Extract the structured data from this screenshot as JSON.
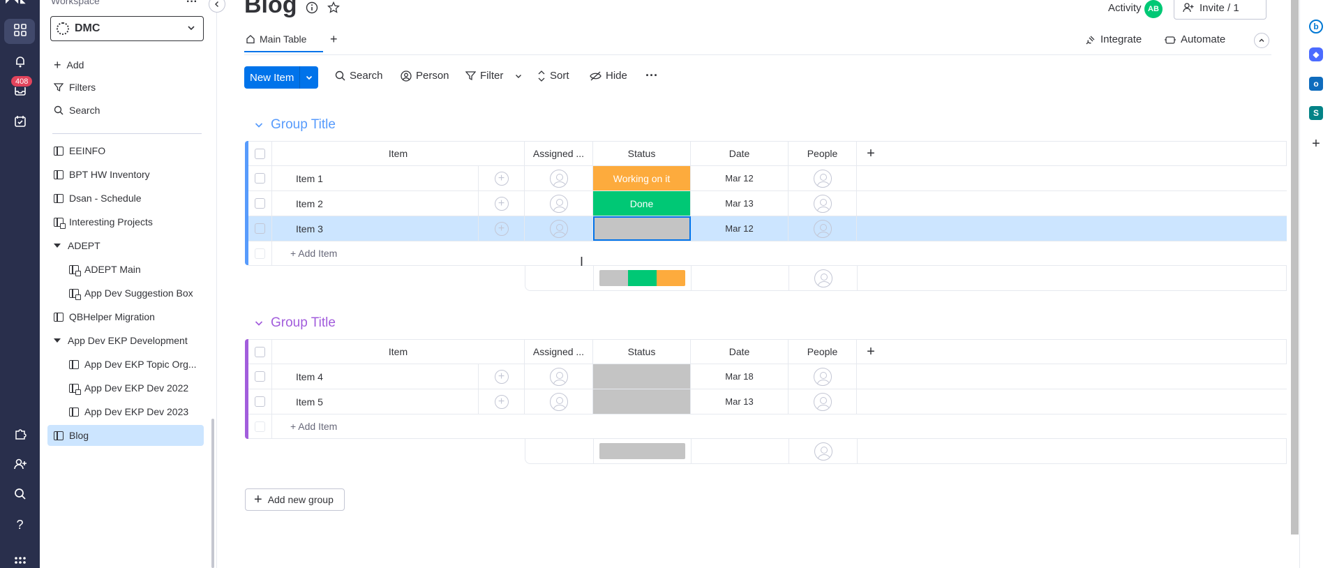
{
  "rail": {
    "inbox_badge": "408"
  },
  "sidebar": {
    "workspace_label": "Workspace",
    "workspace_name": "DMC",
    "actions": [
      {
        "label": "Add",
        "icon": "plus-icon"
      },
      {
        "label": "Filters",
        "icon": "filter-icon"
      },
      {
        "label": "Search",
        "icon": "search-icon"
      }
    ],
    "items": [
      {
        "label": "EEINFO",
        "icon": "board-icon"
      },
      {
        "label": "BPT HW Inventory",
        "icon": "board-icon"
      },
      {
        "label": "Dsan - Schedule",
        "icon": "board-icon"
      },
      {
        "label": "Interesting Projects",
        "icon": "private-board-icon"
      },
      {
        "label": "ADEPT",
        "icon": "folder-caret-icon"
      },
      {
        "label": "ADEPT Main",
        "icon": "private-board-icon"
      },
      {
        "label": "App Dev Suggestion Box",
        "icon": "private-board-icon"
      },
      {
        "label": "QBHelper Migration",
        "icon": "board-icon"
      },
      {
        "label": "App Dev EKP Development",
        "icon": "folder-caret-icon"
      },
      {
        "label": "App Dev EKP Topic Org...",
        "icon": "board-icon"
      },
      {
        "label": "App Dev EKP Dev 2022",
        "icon": "private-board-icon"
      },
      {
        "label": "App Dev EKP Dev 2023",
        "icon": "board-icon"
      },
      {
        "label": "Blog",
        "icon": "board-icon"
      }
    ]
  },
  "header": {
    "title": "Blog",
    "activity_label": "Activity",
    "avatar_initials": "AB",
    "invite_label": "Invite / 1",
    "tab_label": "Main Table",
    "integrate_label": "Integrate",
    "automate_label": "Automate"
  },
  "toolbar": {
    "new_item": "New Item",
    "search": "Search",
    "person": "Person",
    "filter": "Filter",
    "sort": "Sort",
    "hide": "Hide"
  },
  "columns": {
    "item": "Item",
    "assigned": "Assigned ...",
    "status": "Status",
    "date": "Date",
    "people": "People"
  },
  "groups": [
    {
      "title": "Group Title",
      "color": "#579bfc",
      "add_item": "+ Add Item",
      "rows": [
        {
          "name": "Item 1",
          "status": "Working on it",
          "status_color": "#fdab3d",
          "date": "Mar 12"
        },
        {
          "name": "Item 2",
          "status": "Done",
          "status_color": "#00c875",
          "date": "Mar 13"
        },
        {
          "name": "Item 3",
          "status": "",
          "status_color": "#c4c4c4",
          "date": "Mar 12"
        }
      ]
    },
    {
      "title": "Group Title",
      "color": "#a25ddc",
      "add_item": "+ Add Item",
      "rows": [
        {
          "name": "Item 4",
          "status": "",
          "status_color": "#c4c4c4",
          "date": "Mar 18"
        },
        {
          "name": "Item 5",
          "status": "",
          "status_color": "#c4c4c4",
          "date": "Mar 13"
        }
      ]
    }
  ],
  "add_group_label": "Add new group",
  "colors": {
    "primary": "#0073ea",
    "rail": "#292f4c",
    "selected": "#cce5ff",
    "empty_status": "#c4c4c4"
  }
}
